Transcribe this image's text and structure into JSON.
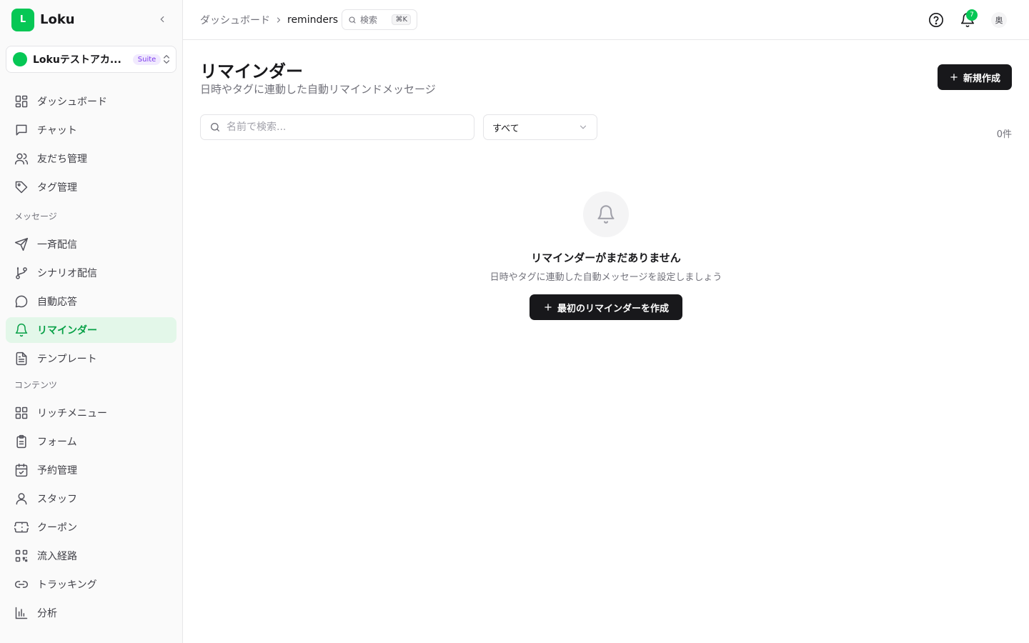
{
  "brand": {
    "logo_letter": "L",
    "name": "Loku"
  },
  "account": {
    "name": "Lokuテストアカ...",
    "plan_badge": "Suite"
  },
  "sidebar": {
    "main_items": [
      {
        "label": "ダッシュボード",
        "icon": "dashboard-grid-icon"
      },
      {
        "label": "チャット",
        "icon": "chat-icon"
      },
      {
        "label": "友だち管理",
        "icon": "users-icon"
      },
      {
        "label": "タグ管理",
        "icon": "tag-icon"
      }
    ],
    "message_section": "メッセージ",
    "message_items": [
      {
        "label": "一斉配信",
        "icon": "send-icon"
      },
      {
        "label": "シナリオ配信",
        "icon": "branch-icon"
      },
      {
        "label": "自動応答",
        "icon": "message-circle-icon"
      },
      {
        "label": "リマインダー",
        "icon": "bell-icon",
        "active": true
      },
      {
        "label": "テンプレート",
        "icon": "file-text-icon"
      }
    ],
    "content_section": "コンテンツ",
    "content_items": [
      {
        "label": "リッチメニュー",
        "icon": "grid-icon"
      },
      {
        "label": "フォーム",
        "icon": "clipboard-icon"
      },
      {
        "label": "予約管理",
        "icon": "calendar-check-icon"
      },
      {
        "label": "スタッフ",
        "icon": "user-icon"
      },
      {
        "label": "クーポン",
        "icon": "ticket-icon"
      },
      {
        "label": "流入経路",
        "icon": "qr-code-icon"
      },
      {
        "label": "トラッキング",
        "icon": "link-icon"
      },
      {
        "label": "分析",
        "icon": "bar-chart-icon"
      }
    ]
  },
  "topbar": {
    "breadcrumb_parent": "ダッシュボード",
    "breadcrumb_current": "reminders",
    "search_label": "検索",
    "search_shortcut": "⌘K",
    "notification_count": "7",
    "avatar_initial": "奥"
  },
  "main": {
    "title": "リマインダー",
    "subtitle": "日時やタグに連動した自動リマインドメッセージ",
    "new_button": "新規作成",
    "search_placeholder": "名前で検索...",
    "filter_value": "すべて",
    "count": "0件",
    "empty_title": "リマインダーがまだありません",
    "empty_subtitle": "日時やタグに連動した自動メッセージを設定しましょう",
    "empty_button": "最初のリマインダーを作成"
  },
  "colors": {
    "brand": "#06c755",
    "active_bg": "#e3f7e9",
    "active_text": "#06a046",
    "primary_button": "#18181b"
  }
}
